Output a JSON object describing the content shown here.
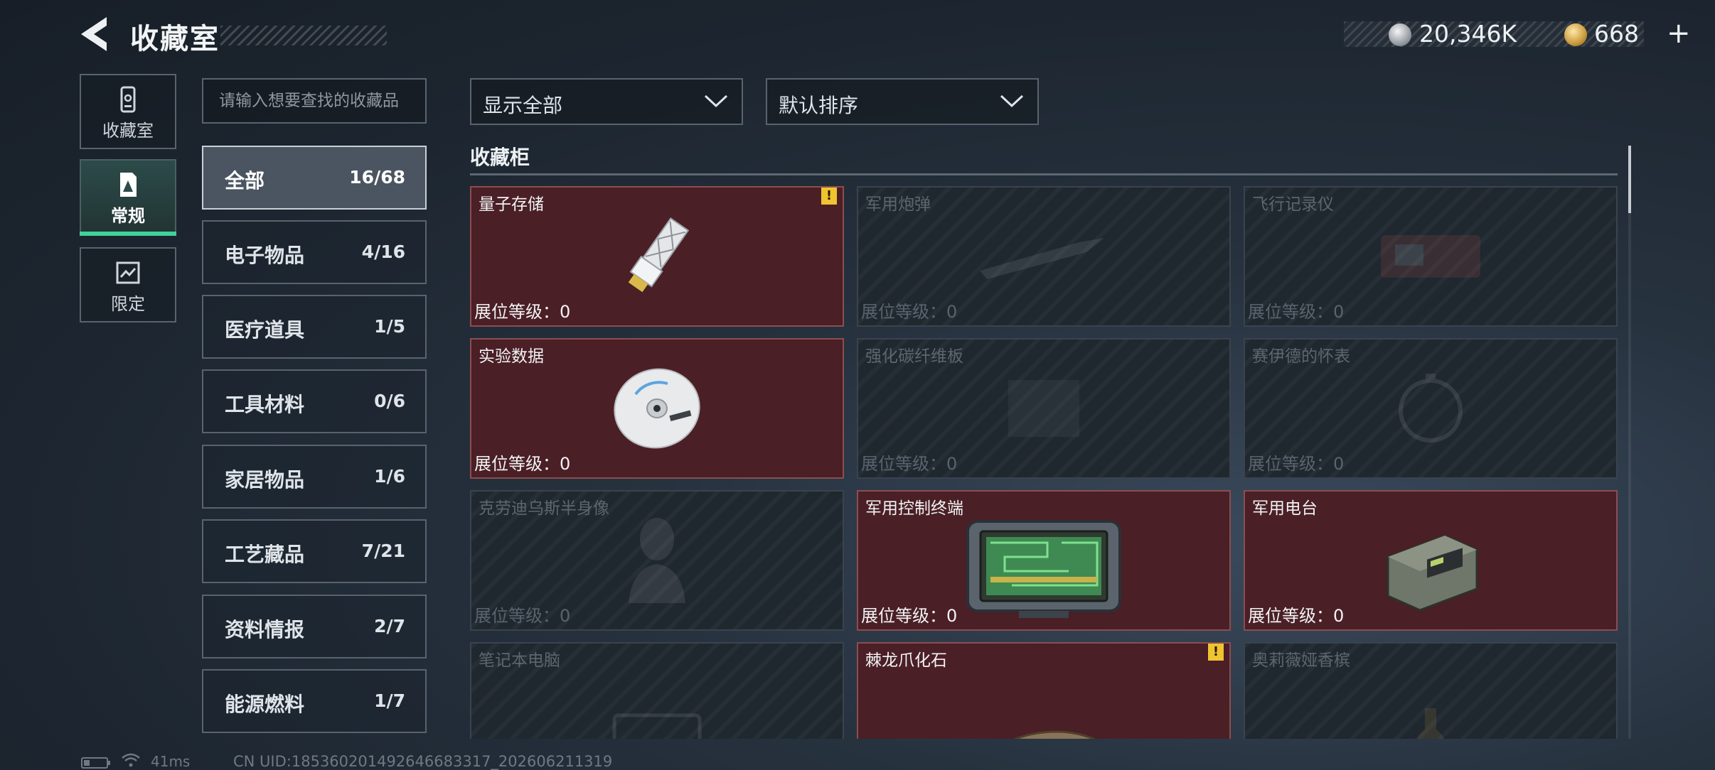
{
  "header": {
    "title": "收藏室",
    "currency_silver": "20,346K",
    "currency_gold": "668",
    "currency_gold_plus": "+"
  },
  "nav": {
    "tabs": [
      {
        "label": "收藏室",
        "icon": "trophy-cabinet-icon"
      },
      {
        "label": "常规",
        "icon": "regular-collection-icon",
        "active": true
      },
      {
        "label": "限定",
        "icon": "limited-collection-icon"
      }
    ]
  },
  "search": {
    "placeholder": "请输入想要查找的收藏品"
  },
  "categories": [
    {
      "label": "全部",
      "count": "16/68",
      "active": true
    },
    {
      "label": "电子物品",
      "count": "4/16"
    },
    {
      "label": "医疗道具",
      "count": "1/5"
    },
    {
      "label": "工具材料",
      "count": "0/6"
    },
    {
      "label": "家居物品",
      "count": "1/6"
    },
    {
      "label": "工艺藏品",
      "count": "7/21"
    },
    {
      "label": "资料情报",
      "count": "2/7"
    },
    {
      "label": "能源燃料",
      "count": "1/7"
    }
  ],
  "filters": {
    "show": "显示全部",
    "sort": "默认排序"
  },
  "section_title": "收藏柜",
  "items": [
    {
      "name": "量子存储",
      "level": "展位等级：0",
      "unlocked": true,
      "alert": true,
      "icon": "usb-drive-icon"
    },
    {
      "name": "军用炮弹",
      "level": "展位等级：0",
      "unlocked": false,
      "icon": "artillery-shell-icon"
    },
    {
      "name": "飞行记录仪",
      "level": "展位等级：0",
      "unlocked": false,
      "icon": "flight-recorder-icon"
    },
    {
      "name": "实验数据",
      "level": "展位等级：0",
      "unlocked": true,
      "icon": "disc-icon"
    },
    {
      "name": "强化碳纤维板",
      "level": "展位等级：0",
      "unlocked": false,
      "icon": "carbon-plate-icon"
    },
    {
      "name": "赛伊德的怀表",
      "level": "展位等级：0",
      "unlocked": false,
      "icon": "pocket-watch-icon"
    },
    {
      "name": "克劳迪乌斯半身像",
      "level": "展位等级：0",
      "unlocked": false,
      "icon": "bust-statue-icon"
    },
    {
      "name": "军用控制终端",
      "level": "展位等级：0",
      "unlocked": true,
      "icon": "control-terminal-icon"
    },
    {
      "name": "军用电台",
      "level": "展位等级：0",
      "unlocked": true,
      "icon": "military-radio-icon"
    },
    {
      "name": "笔记本电脑",
      "level": "",
      "unlocked": false,
      "icon": "laptop-icon"
    },
    {
      "name": "棘龙爪化石",
      "level": "",
      "unlocked": true,
      "alert": true,
      "icon": "claw-fossil-icon"
    },
    {
      "name": "奥莉薇娅香槟",
      "level": "",
      "unlocked": false,
      "icon": "champagne-icon"
    }
  ],
  "alert_symbol": "!",
  "footer": {
    "ping": "41ms",
    "uid": "CN UID:18536020149264​6683317_202606211319"
  },
  "colors": {
    "accent_green": "#3fd39a",
    "unlocked_card": "#4a1f25",
    "alert_yellow": "#f0c431"
  }
}
